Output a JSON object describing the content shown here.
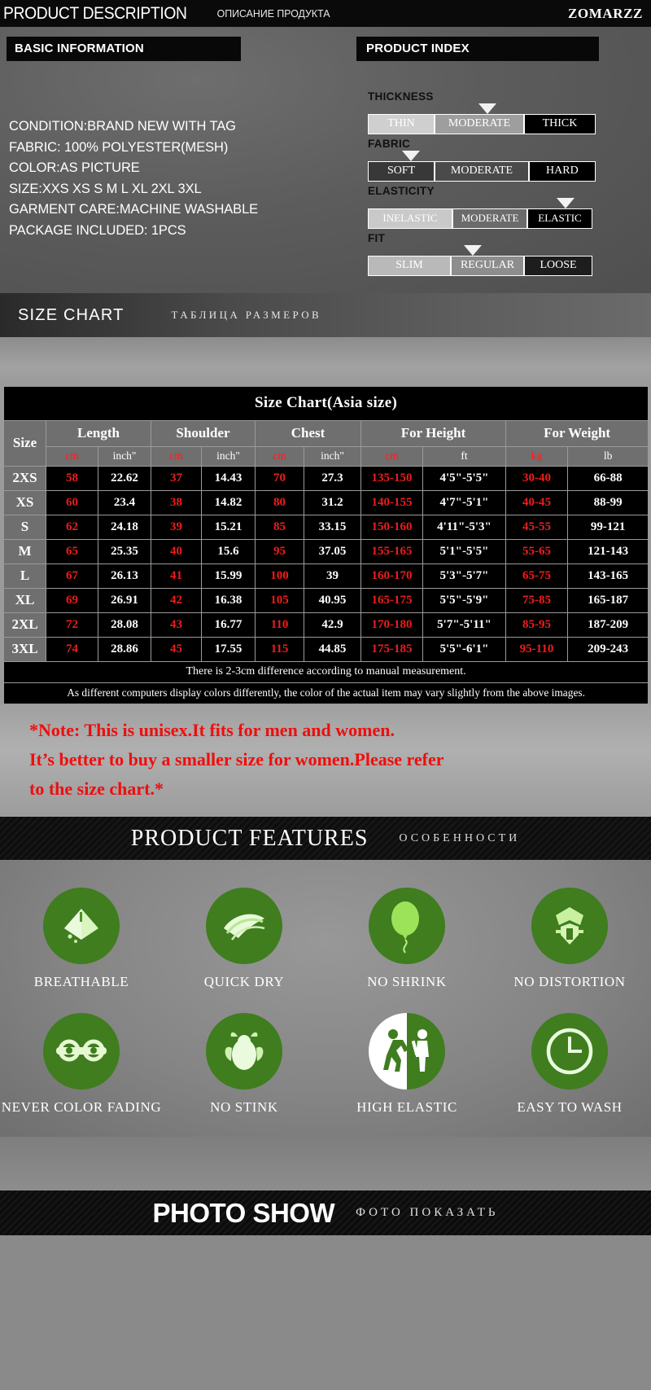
{
  "header": {
    "title_en": "PRODUCT DESCRIPTION",
    "title_ru": "ОПИСАНИЕ ПРОДУКТА",
    "brand": "ZOMARZZ"
  },
  "basic_information": {
    "panel_title": "BASIC INFORMATION",
    "lines": [
      "CONDITION:BRAND NEW WITH TAG",
      "FABRIC:  100% POLYESTER(MESH)",
      "COLOR:AS PICTURE",
      "SIZE:XXS XS S M L XL 2XL 3XL",
      "GARMENT CARE:MACHINE WASHABLE",
      "PACKAGE INCLUDED: 1PCS"
    ]
  },
  "product_index": {
    "panel_title": "PRODUCT INDEX",
    "groups": [
      {
        "label": "THICKNESS",
        "options": [
          "THIN",
          "MODERATE",
          "THICK"
        ],
        "selected": "THICK",
        "marker_index": 1
      },
      {
        "label": "FABRIC",
        "options": [
          "SOFT",
          "MODERATE",
          "HARD"
        ],
        "selected": "HARD",
        "marker_index": 0
      },
      {
        "label": "ELASTICITY",
        "options": [
          "INELASTIC",
          "MODERATE",
          "ELASTIC"
        ],
        "selected": "ELASTIC",
        "marker_index": 2
      },
      {
        "label": "FIT",
        "options": [
          "SLIM",
          "REGULAR",
          "LOOSE"
        ],
        "selected": "LOOSE",
        "marker_index": 1
      }
    ]
  },
  "size_chart_strip": {
    "title_en": "SIZE CHART",
    "title_ru": "ТАБЛИЦА РАЗМЕРОВ"
  },
  "size_chart": {
    "caption": "Size Chart(Asia size)",
    "group_headers": [
      "Size",
      "Length",
      "Shoulder",
      "Chest",
      "For Height",
      "For Weight"
    ],
    "unit_headers": [
      "",
      "cm",
      "inch\"",
      "cm",
      "inch\"",
      "cm",
      "inch\"",
      "cm",
      "ft",
      "kg",
      "lb"
    ],
    "rows": [
      {
        "size": "2XS",
        "cells": [
          "58",
          "22.62",
          "37",
          "14.43",
          "70",
          "27.3",
          "135-150",
          "4'5\"-5'5\"",
          "30-40",
          "66-88"
        ]
      },
      {
        "size": "XS",
        "cells": [
          "60",
          "23.4",
          "38",
          "14.82",
          "80",
          "31.2",
          "140-155",
          "4'7\"-5'1\"",
          "40-45",
          "88-99"
        ]
      },
      {
        "size": "S",
        "cells": [
          "62",
          "24.18",
          "39",
          "15.21",
          "85",
          "33.15",
          "150-160",
          "4'11\"-5'3\"",
          "45-55",
          "99-121"
        ]
      },
      {
        "size": "M",
        "cells": [
          "65",
          "25.35",
          "40",
          "15.6",
          "95",
          "37.05",
          "155-165",
          "5'1\"-5'5\"",
          "55-65",
          "121-143"
        ]
      },
      {
        "size": "L",
        "cells": [
          "67",
          "26.13",
          "41",
          "15.99",
          "100",
          "39",
          "160-170",
          "5'3\"-5'7\"",
          "65-75",
          "143-165"
        ]
      },
      {
        "size": "XL",
        "cells": [
          "69",
          "26.91",
          "42",
          "16.38",
          "105",
          "40.95",
          "165-175",
          "5'5\"-5'9\"",
          "75-85",
          "165-187"
        ]
      },
      {
        "size": "2XL",
        "cells": [
          "72",
          "28.08",
          "43",
          "16.77",
          "110",
          "42.9",
          "170-180",
          "5'7\"-5'11\"",
          "85-95",
          "187-209"
        ]
      },
      {
        "size": "3XL",
        "cells": [
          "74",
          "28.86",
          "45",
          "17.55",
          "115",
          "44.85",
          "175-185",
          "5'5\"-6'1\"",
          "95-110",
          "209-243"
        ]
      }
    ],
    "footnote_1": "There is 2-3cm difference according to manual measurement.",
    "footnote_2": "As different computers display colors differently, the color of the actual item may vary slightly from the above images."
  },
  "red_note": {
    "line1": "*Note:  This is unisex.It fits for men and women.",
    "line2": "It’s better to buy a smaller size for women.Please refer",
    "line3": " to the size chart.*",
    "color": "#f00d0d"
  },
  "features_banner": {
    "title_en": "PRODUCT  FEATURES",
    "title_ru": "ОСОБЕННОСТИ"
  },
  "features": {
    "accent_color": "#3f7d1f",
    "row1": [
      {
        "icon": "breathable-icon",
        "label": "BREATHABLE"
      },
      {
        "icon": "quick-dry-icon",
        "label": "QUICK DRY"
      },
      {
        "icon": "no-shrink-balloon-icon",
        "label": "NO SHRINK"
      },
      {
        "icon": "no-distortion-icon",
        "label": "NO DISTORTION"
      }
    ],
    "row2": [
      {
        "icon": "never-color-fading-icon",
        "label": "NEVER COLOR FADING"
      },
      {
        "icon": "no-stink-icon",
        "label": "NO STINK"
      },
      {
        "icon": "high-elastic-icon",
        "label": "HIGH ELASTIC"
      },
      {
        "icon": "easy-to-wash-clock-icon",
        "label": "EASY TO WASH"
      }
    ]
  },
  "photo_show": {
    "title_en": "PHOTO SHOW",
    "title_ru": "ФОТО ПОКАЗАТЬ"
  }
}
